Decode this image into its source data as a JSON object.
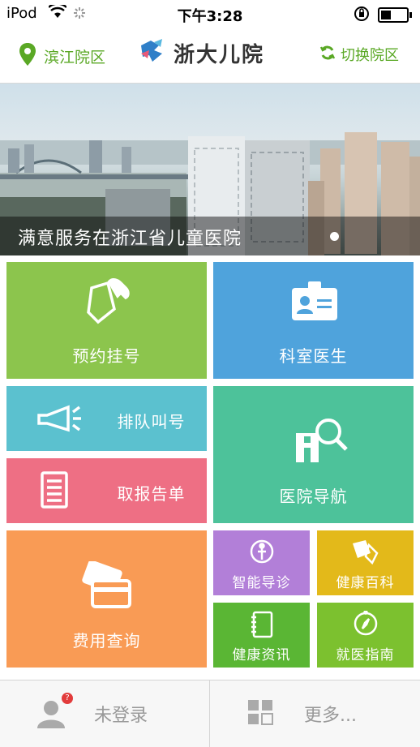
{
  "status_bar": {
    "carrier": "iPod",
    "time": "下午3:28"
  },
  "header": {
    "campus": "滨江院区",
    "title": "浙大儿院",
    "switch": "切换院区"
  },
  "banner": {
    "caption": "满意服务在浙江省儿童医院"
  },
  "tiles": {
    "appointment": {
      "label": "预约挂号",
      "icon": "phone-document-icon",
      "color": "#8cc54d"
    },
    "department_doctor": {
      "label": "科室医生",
      "icon": "doctor-badge-icon",
      "color": "#4fa3dc"
    },
    "queue": {
      "label": "排队叫号",
      "icon": "megaphone-icon",
      "color": "#5bc1cf"
    },
    "report": {
      "label": "取报告单",
      "icon": "report-list-icon",
      "color": "#ee6f84"
    },
    "navigation": {
      "label": "医院导航",
      "icon": "hospital-search-icon",
      "color": "#4dc29a"
    },
    "payment": {
      "label": "费用查询",
      "icon": "card-icon",
      "color": "#f99b55"
    },
    "smart_triage": {
      "label": "智能导诊",
      "icon": "body-scan-icon",
      "color": "#b27fd8"
    },
    "encyclopedia": {
      "label": "健康百科",
      "icon": "book-pen-icon",
      "color": "#e3b91a"
    },
    "news": {
      "label": "健康资讯",
      "icon": "notebook-icon",
      "color": "#5ab634"
    },
    "guide": {
      "label": "就医指南",
      "icon": "compass-icon",
      "color": "#7cc12f"
    }
  },
  "footer": {
    "login": "未登录",
    "more": "更多...",
    "badge": "?"
  }
}
